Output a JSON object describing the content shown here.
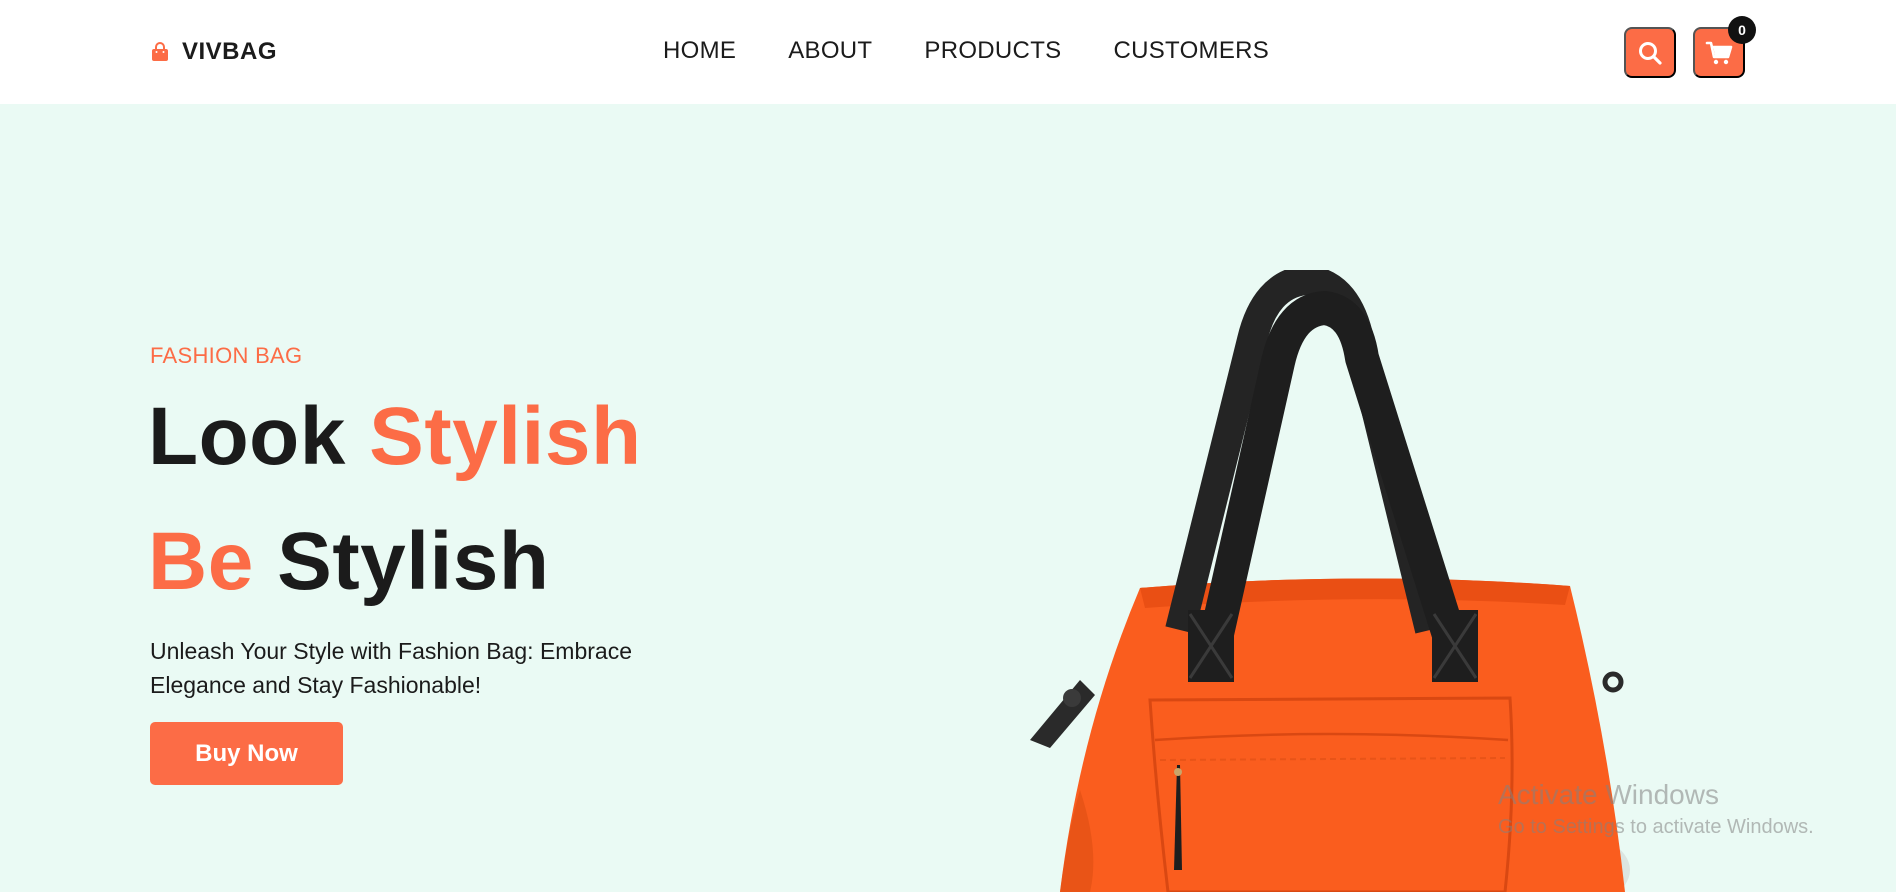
{
  "theme": {
    "accent": "#fc6c46",
    "background": "#eafaf4",
    "nav_background": "#ffffff",
    "text": "#1b1b1b",
    "badge": "#111111"
  },
  "navbar": {
    "logo": {
      "icon": "shopping-bag-icon",
      "text": "VIVBAG"
    },
    "links": [
      "HOME",
      "ABOUT",
      "PRODUCTS",
      "CUSTOMERS"
    ],
    "search_icon": "search-icon",
    "cart": {
      "icon": "cart-icon",
      "count": "0"
    }
  },
  "hero": {
    "eyebrow": "FASHION BAG",
    "headline_line1": {
      "plain": "Look",
      "accent": "Stylish"
    },
    "headline_line2": {
      "accent": "Be",
      "plain": "Stylish"
    },
    "description": "Unleash Your Style with Fashion Bag: Embrace Elegance and Stay Fashionable!",
    "cta_label": "Buy Now",
    "image": "orange-handbag-image"
  },
  "watermark": {
    "title": "Activate Windows",
    "subtitle": "Go to Settings to activate Windows."
  }
}
